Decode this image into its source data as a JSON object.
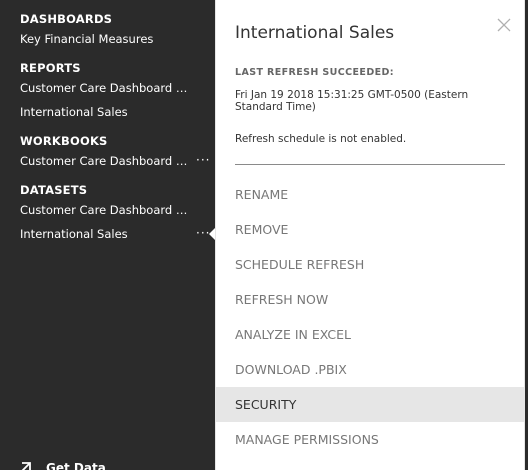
{
  "nav": {
    "sections": [
      {
        "header": "DASHBOARDS",
        "items": [
          {
            "label": "Key Financial Measures",
            "has_more": false
          }
        ]
      },
      {
        "header": "REPORTS",
        "items": [
          {
            "label": "Customer Care Dashboard Po...",
            "has_more": false
          },
          {
            "label": "International Sales",
            "has_more": false
          }
        ]
      },
      {
        "header": "WORKBOOKS",
        "items": [
          {
            "label": "Customer Care Dashboard Po...",
            "has_more": true
          }
        ]
      },
      {
        "header": "DATASETS",
        "items": [
          {
            "label": "Customer Care Dashboard Po...",
            "has_more": false
          },
          {
            "label": "International Sales",
            "has_more": true
          }
        ]
      }
    ],
    "more_label": "···",
    "get_data_label": "Get Data",
    "get_data_icon": "arrow-up-right-icon"
  },
  "panel": {
    "title": "International Sales",
    "close_icon": "close-icon",
    "refresh_label": "LAST REFRESH SUCCEEDED:",
    "refresh_time": "Fri Jan 19 2018 15:31:25 GMT-0500 (Eastern Standard Time)",
    "schedule_status": "Refresh schedule is not enabled.",
    "menu": [
      {
        "label": "RENAME"
      },
      {
        "label": "REMOVE"
      },
      {
        "label": "SCHEDULE REFRESH"
      },
      {
        "label": "REFRESH NOW"
      },
      {
        "label": "ANALYZE IN EXCEL"
      },
      {
        "label": "DOWNLOAD .PBIX"
      },
      {
        "label": "SECURITY",
        "highlighted": true
      },
      {
        "label": "MANAGE PERMISSIONS"
      }
    ]
  },
  "colors": {
    "nav_background": "#2b2b2b",
    "panel_background": "#ffffff",
    "menu_highlight": "#e6e6e6",
    "menu_text": "#777777"
  }
}
